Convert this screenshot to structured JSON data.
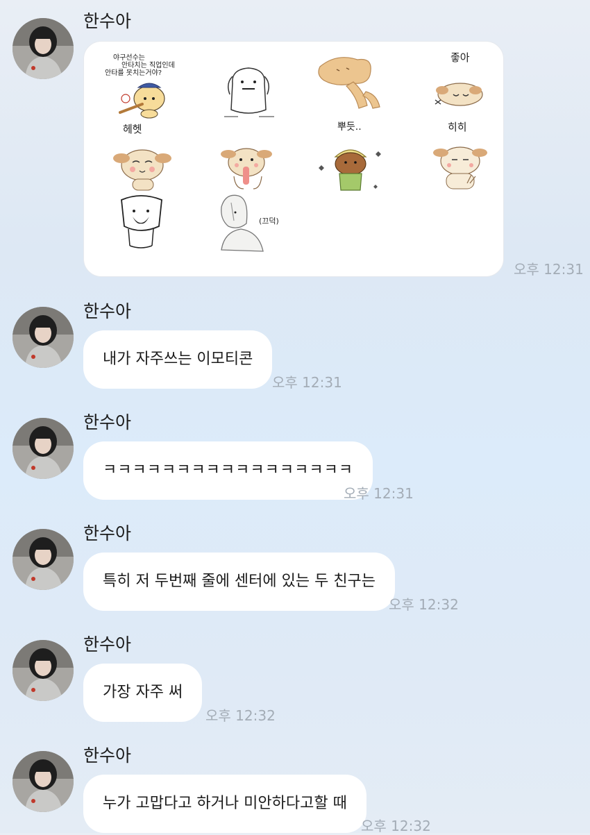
{
  "sender_name": "한수아",
  "messages": [
    {
      "type": "sticker_pack",
      "time": "오후 12:31"
    },
    {
      "type": "text",
      "text": "내가 자주쓰는 이모티콘",
      "time": "오후 12:31"
    },
    {
      "type": "text",
      "text": "ㅋㅋㅋㅋㅋㅋㅋㅋㅋㅋㅋㅋㅋㅋㅋㅋㅋ",
      "time": "오후 12:31"
    },
    {
      "type": "text",
      "text": "특히 저 두번째 줄에 센터에 있는 두 친구는",
      "time": "오후 12:32"
    },
    {
      "type": "text",
      "text": "가장 자주 써",
      "time": "오후 12:32"
    },
    {
      "type": "text",
      "text": "누가 고맙다고 하거나 미안하다고할 때",
      "time": "오후 12:32"
    }
  ],
  "stickers": {
    "s1_lines": [
      "야구선수는",
      "안타치는 직업인데",
      "안타를 못치는거야?"
    ],
    "s4_label": "좋아",
    "s5_label": "헤헷",
    "s7_label": "뿌듯..",
    "s8_label": "히히",
    "s10_label": "(끄덕)"
  },
  "colors": {
    "bubble": "#ffffff",
    "time": "#a3acb6",
    "puppy_body": "#f3e2c4",
    "puppy_ear": "#d9a978"
  }
}
